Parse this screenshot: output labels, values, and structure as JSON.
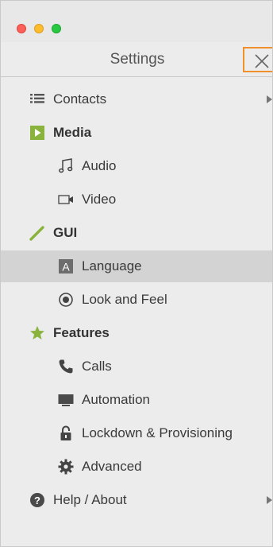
{
  "header": {
    "title": "Settings"
  },
  "nav": {
    "contacts": "Contacts",
    "media": "Media",
    "audio": "Audio",
    "video": "Video",
    "gui": "GUI",
    "language": "Language",
    "look_and_feel": "Look and Feel",
    "features": "Features",
    "calls": "Calls",
    "automation": "Automation",
    "lockdown": "Lockdown & Provisioning",
    "advanced": "Advanced",
    "help_about": "Help / About"
  },
  "colors": {
    "accent_green": "#8ab33d",
    "close_outline": "#f0902d",
    "selected_row": "#d3d3d3",
    "traffic_red": "#fc5f57",
    "traffic_yellow": "#fdbc2e",
    "traffic_green": "#28c840"
  },
  "icons": {
    "contacts": "list-icon",
    "media": "play-icon",
    "audio": "music-note-icon",
    "video": "video-camera-icon",
    "gui": "pencil-icon",
    "language": "letter-a-icon",
    "look_and_feel": "radio-dot-icon",
    "features": "star-icon",
    "calls": "phone-icon",
    "automation": "monitor-icon",
    "lockdown": "lock-icon",
    "advanced": "gear-icon",
    "help_about": "question-circle-icon"
  }
}
